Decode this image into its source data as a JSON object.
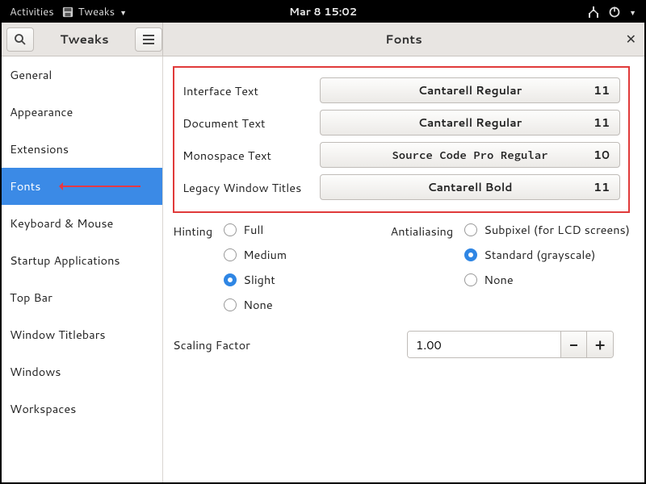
{
  "topbar": {
    "activities": "Activities",
    "app_name": "Tweaks",
    "datetime": "Mar 8  15:02"
  },
  "header": {
    "left_title": "Tweaks",
    "right_title": "Fonts"
  },
  "sidebar": {
    "items": [
      {
        "label": "General"
      },
      {
        "label": "Appearance"
      },
      {
        "label": "Extensions"
      },
      {
        "label": "Fonts",
        "selected": true
      },
      {
        "label": "Keyboard & Mouse"
      },
      {
        "label": "Startup Applications"
      },
      {
        "label": "Top Bar"
      },
      {
        "label": "Window Titlebars"
      },
      {
        "label": "Windows"
      },
      {
        "label": "Workspaces"
      }
    ]
  },
  "fonts": {
    "rows": [
      {
        "label": "Interface Text",
        "font": "Cantarell Regular",
        "size": "11"
      },
      {
        "label": "Document Text",
        "font": "Cantarell Regular",
        "size": "11"
      },
      {
        "label": "Monospace Text",
        "font": "Source Code Pro Regular",
        "size": "10",
        "mono": true
      },
      {
        "label": "Legacy Window Titles",
        "font": "Cantarell Bold",
        "size": "11"
      }
    ]
  },
  "hinting": {
    "label": "Hinting",
    "options": [
      "Full",
      "Medium",
      "Slight",
      "None"
    ],
    "selected": "Slight"
  },
  "antialiasing": {
    "label": "Antialiasing",
    "options": [
      "Subpixel (for LCD screens)",
      "Standard (grayscale)",
      "None"
    ],
    "selected": "Standard (grayscale)"
  },
  "scaling": {
    "label": "Scaling Factor",
    "value": "1.00"
  }
}
